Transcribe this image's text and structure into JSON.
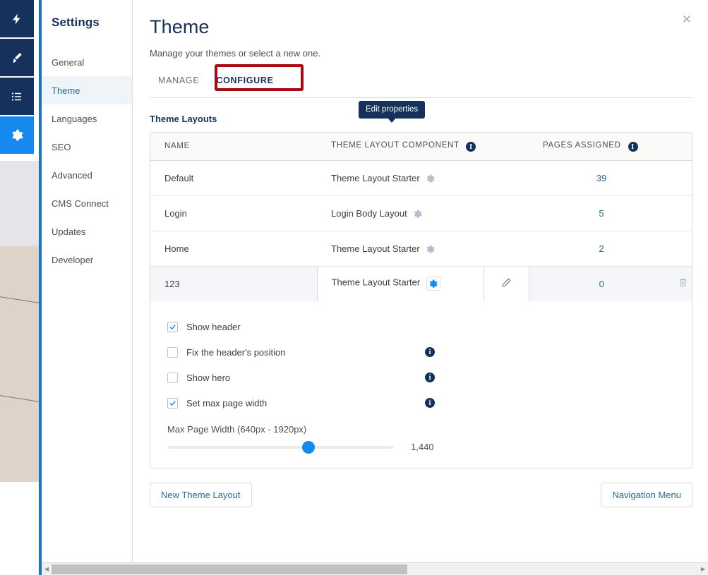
{
  "rail": {
    "items": [
      {
        "name": "lightning-icon",
        "label": "Lightning"
      },
      {
        "name": "brush-icon",
        "label": "Theme Brush"
      },
      {
        "name": "list-icon",
        "label": "Page List"
      },
      {
        "name": "gear-icon",
        "label": "Settings"
      }
    ]
  },
  "sidebar": {
    "title": "Settings",
    "items": [
      {
        "label": "General",
        "active": false
      },
      {
        "label": "Theme",
        "active": true
      },
      {
        "label": "Languages",
        "active": false
      },
      {
        "label": "SEO",
        "active": false
      },
      {
        "label": "Advanced",
        "active": false
      },
      {
        "label": "CMS Connect",
        "active": false
      },
      {
        "label": "Updates",
        "active": false
      },
      {
        "label": "Developer",
        "active": false
      }
    ]
  },
  "header": {
    "title": "Theme",
    "subtitle": "Manage your themes or select a new one.",
    "close_label": "✕"
  },
  "tabs": [
    {
      "label": "MANAGE",
      "active": false
    },
    {
      "label": "CONFIGURE",
      "active": true
    }
  ],
  "section": {
    "title": "Theme Layouts"
  },
  "table": {
    "columns": [
      {
        "label": "NAME",
        "info": false
      },
      {
        "label": "THEME LAYOUT COMPONENT",
        "info": true
      },
      {
        "label": "PAGES ASSIGNED",
        "info": true
      }
    ],
    "rows": [
      {
        "name": "Default",
        "component": "Theme Layout Starter",
        "pages": "39",
        "selected": false
      },
      {
        "name": "Login",
        "component": "Login Body Layout",
        "pages": "5",
        "selected": false
      },
      {
        "name": "Home",
        "component": "Theme Layout Starter",
        "pages": "2",
        "selected": false
      },
      {
        "name": "123",
        "component": "Theme Layout Starter",
        "pages": "0",
        "selected": true
      }
    ]
  },
  "tooltip": {
    "text": "Edit properties"
  },
  "properties": {
    "checkboxes": [
      {
        "label": "Show header",
        "checked": true,
        "info": false
      },
      {
        "label": "Fix the header's position",
        "checked": false,
        "info": true
      },
      {
        "label": "Show hero",
        "checked": false,
        "info": true
      },
      {
        "label": "Set max page width",
        "checked": true,
        "info": true
      }
    ],
    "slider": {
      "label": "Max Page Width (640px - 1920px)",
      "value_display": "1,440",
      "value": 1440,
      "min": 640,
      "max": 1920,
      "percent": 62.5
    }
  },
  "footer": {
    "new_layout_label": "New Theme Layout",
    "nav_menu_label": "Navigation Menu"
  },
  "scrollbar": {
    "left_arrow": "◀",
    "right_arrow": "▶",
    "thumb_percent": 55
  },
  "colors": {
    "brand_navy": "#16325c",
    "brand_blue": "#1589ee",
    "accent_link": "#2b6a8f",
    "highlight_red": "#a80a14",
    "border": "#dddbda"
  },
  "annotation": {
    "highlight_target": "CONFIGURE"
  }
}
